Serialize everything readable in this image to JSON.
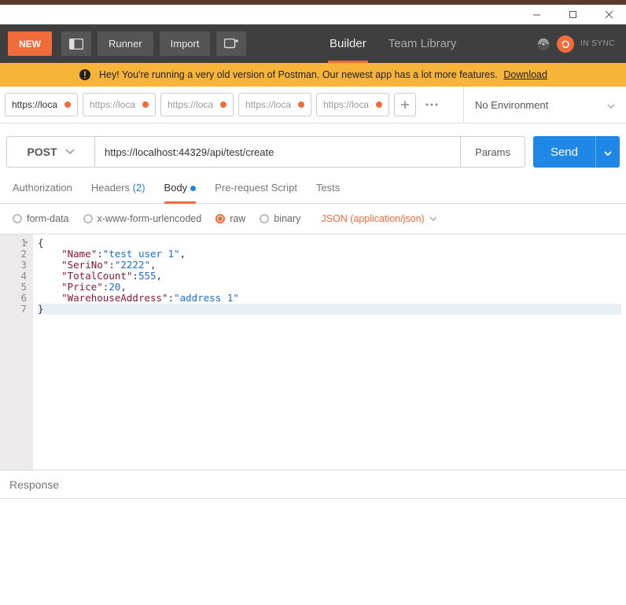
{
  "window": {
    "titlebar": {
      "minimize": "—",
      "maximize": "☐",
      "close": "✕"
    }
  },
  "toolbar": {
    "new_label": "NEW",
    "runner_label": "Runner",
    "import_label": "Import",
    "builder_label": "Builder",
    "team_library_label": "Team Library",
    "sync_label": "IN SYNC"
  },
  "banner": {
    "message": "Hey! You're running a very old version of Postman. Our newest app has a lot more features.",
    "link_text": "Download"
  },
  "tabs": [
    {
      "label": "https://loca",
      "active": true,
      "dirty": true
    },
    {
      "label": "https://loca",
      "active": false,
      "dirty": true
    },
    {
      "label": "https://loca",
      "active": false,
      "dirty": true
    },
    {
      "label": "https://loca",
      "active": false,
      "dirty": true
    },
    {
      "label": "https://loca",
      "active": false,
      "dirty": true
    }
  ],
  "environment": {
    "label": "No Environment"
  },
  "request": {
    "method": "POST",
    "url": "https://localhost:44329/api/test/create",
    "params_label": "Params",
    "send_label": "Send"
  },
  "inner_tabs": {
    "authorization": "Authorization",
    "headers": "Headers",
    "headers_count": "(2)",
    "body": "Body",
    "prerequest": "Pre-request Script",
    "tests": "Tests",
    "active": "body"
  },
  "body_options": {
    "form_data": "form-data",
    "urlencoded": "x-www-form-urlencoded",
    "raw": "raw",
    "binary": "binary",
    "selected": "raw",
    "content_type": "JSON (application/json)"
  },
  "editor": {
    "lines": [
      "{",
      "    \"Name\":\"test user 1\",",
      "    \"SeriNo\":\"2222\",",
      "    \"TotalCount\":555,",
      "    \"Price\":20,",
      "    \"WarehouseAddress\":\"address 1\"",
      "}"
    ],
    "json_value": {
      "Name": "test user 1",
      "SeriNo": "2222",
      "TotalCount": 555,
      "Price": 20,
      "WarehouseAddress": "address 1"
    }
  },
  "response": {
    "label": "Response"
  }
}
